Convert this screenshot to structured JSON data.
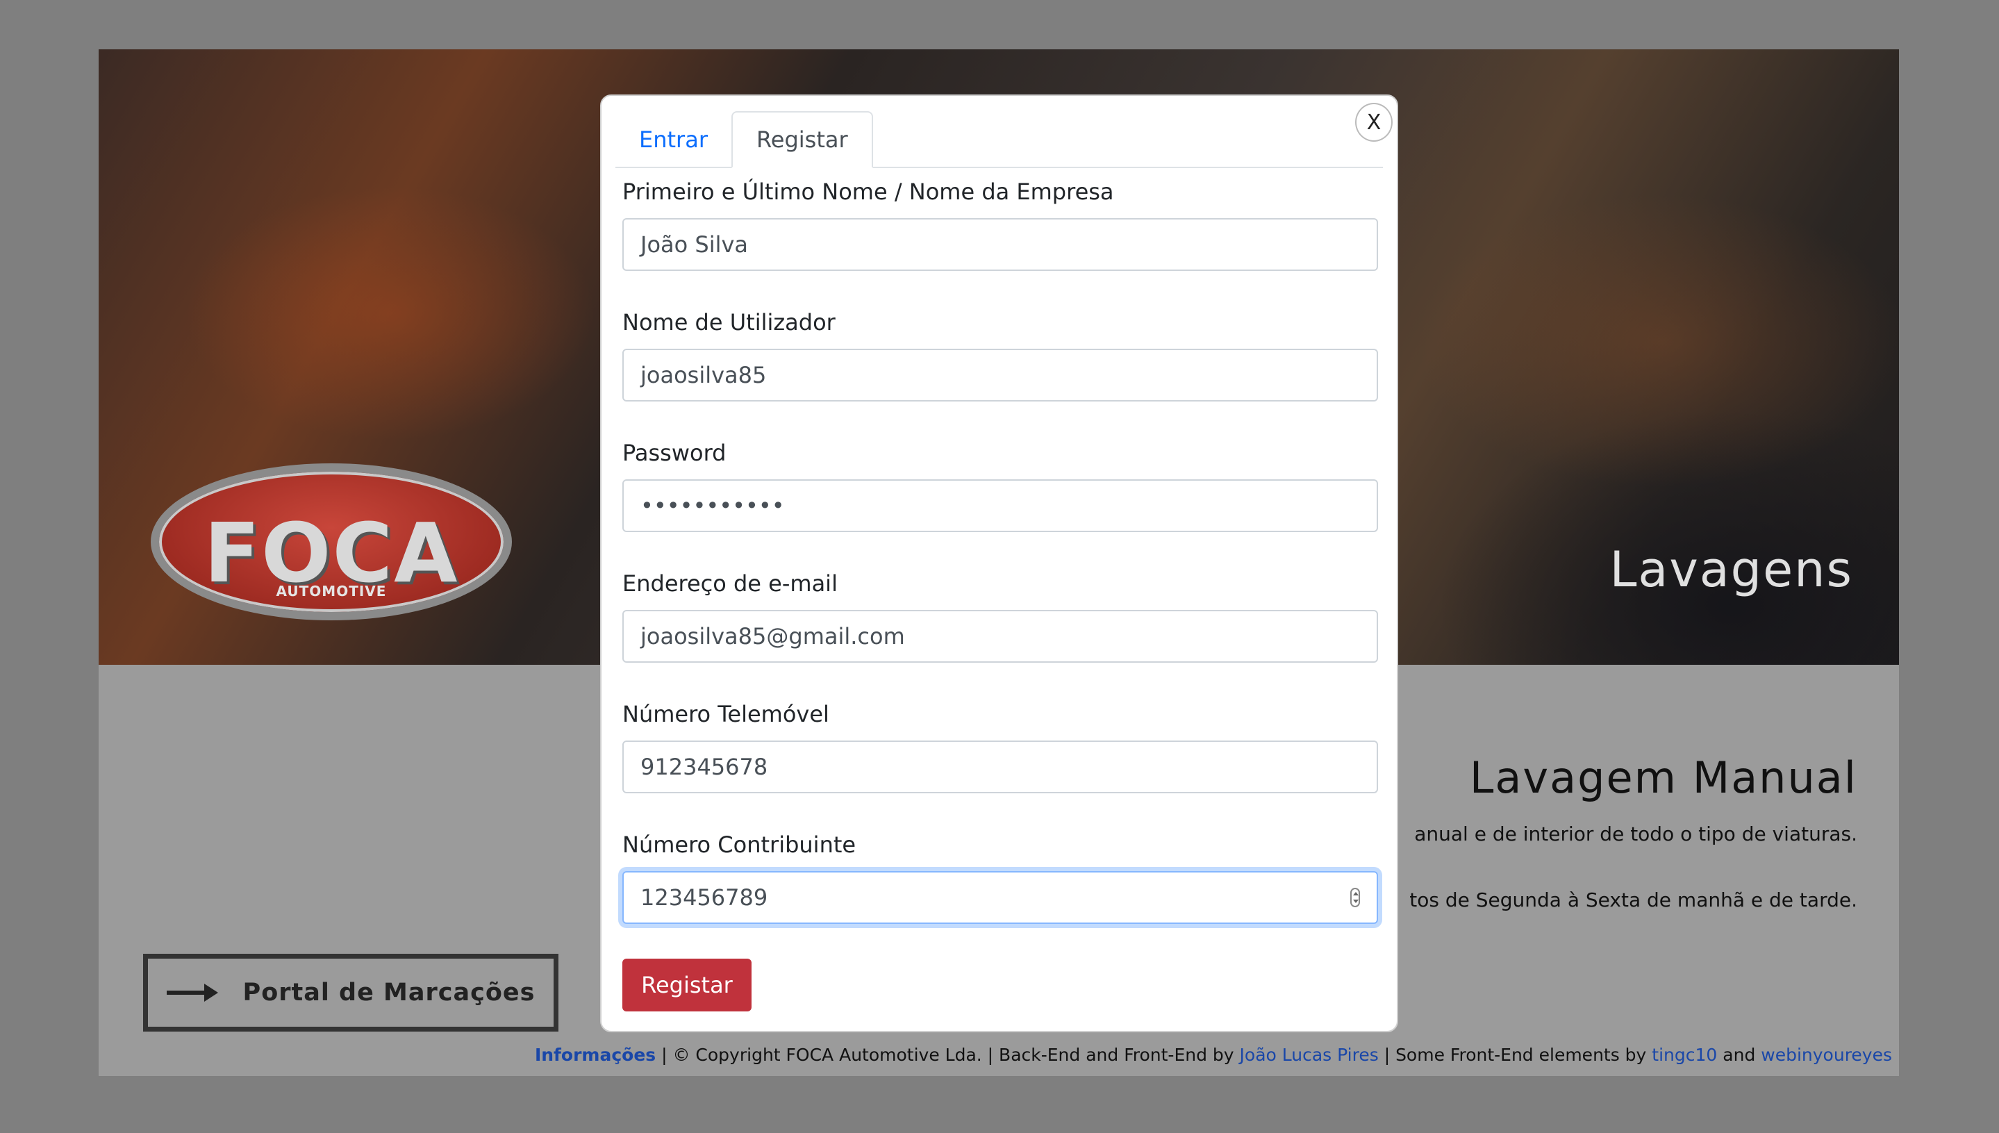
{
  "background_page": {
    "logo": {
      "main": "FOCA",
      "sub": "AUTOMOTIVE"
    },
    "hero_title": "Lavagens",
    "section": {
      "title": "Lavagem Manual",
      "paragraph_1": "anual e de interior de todo o tipo de viaturas.",
      "paragraph_2": "tos de Segunda à Sexta de manhã e de tarde."
    },
    "portal_button": "Portal de Marcações",
    "footer": {
      "info_link": "Informações",
      "text_1": " | © Copyright FOCA Automotive Lda. | Back-End and Front-End by ",
      "author_link": "João Lucas Pires",
      "text_2": " | Some Front-End elements by ",
      "credit_link_1": "tingc10",
      "text_3": " and ",
      "credit_link_2": "webinyoureyes"
    }
  },
  "modal": {
    "close_label": "X",
    "tabs": [
      {
        "label": "Entrar",
        "active": false
      },
      {
        "label": "Registar",
        "active": true
      }
    ],
    "fields": [
      {
        "label": "Primeiro e Último Nome / Nome da Empresa",
        "value": "João Silva"
      },
      {
        "label": "Nome de Utilizador",
        "value": "joaosilva85"
      },
      {
        "label": "Password",
        "value": "•••••••••••"
      },
      {
        "label": "Endereço de e-mail",
        "value": "joaosilva85@gmail.com"
      },
      {
        "label": "Número Telemóvel",
        "value": "912345678"
      },
      {
        "label": "Número Contribuinte",
        "value": "123456789"
      }
    ],
    "submit_label": "Registar"
  },
  "colors": {
    "overlay": "#7f7f7f",
    "tab_active_link": "#0d6efd",
    "submit_button": "#c0323c",
    "footer_link": "#1a47a8"
  }
}
